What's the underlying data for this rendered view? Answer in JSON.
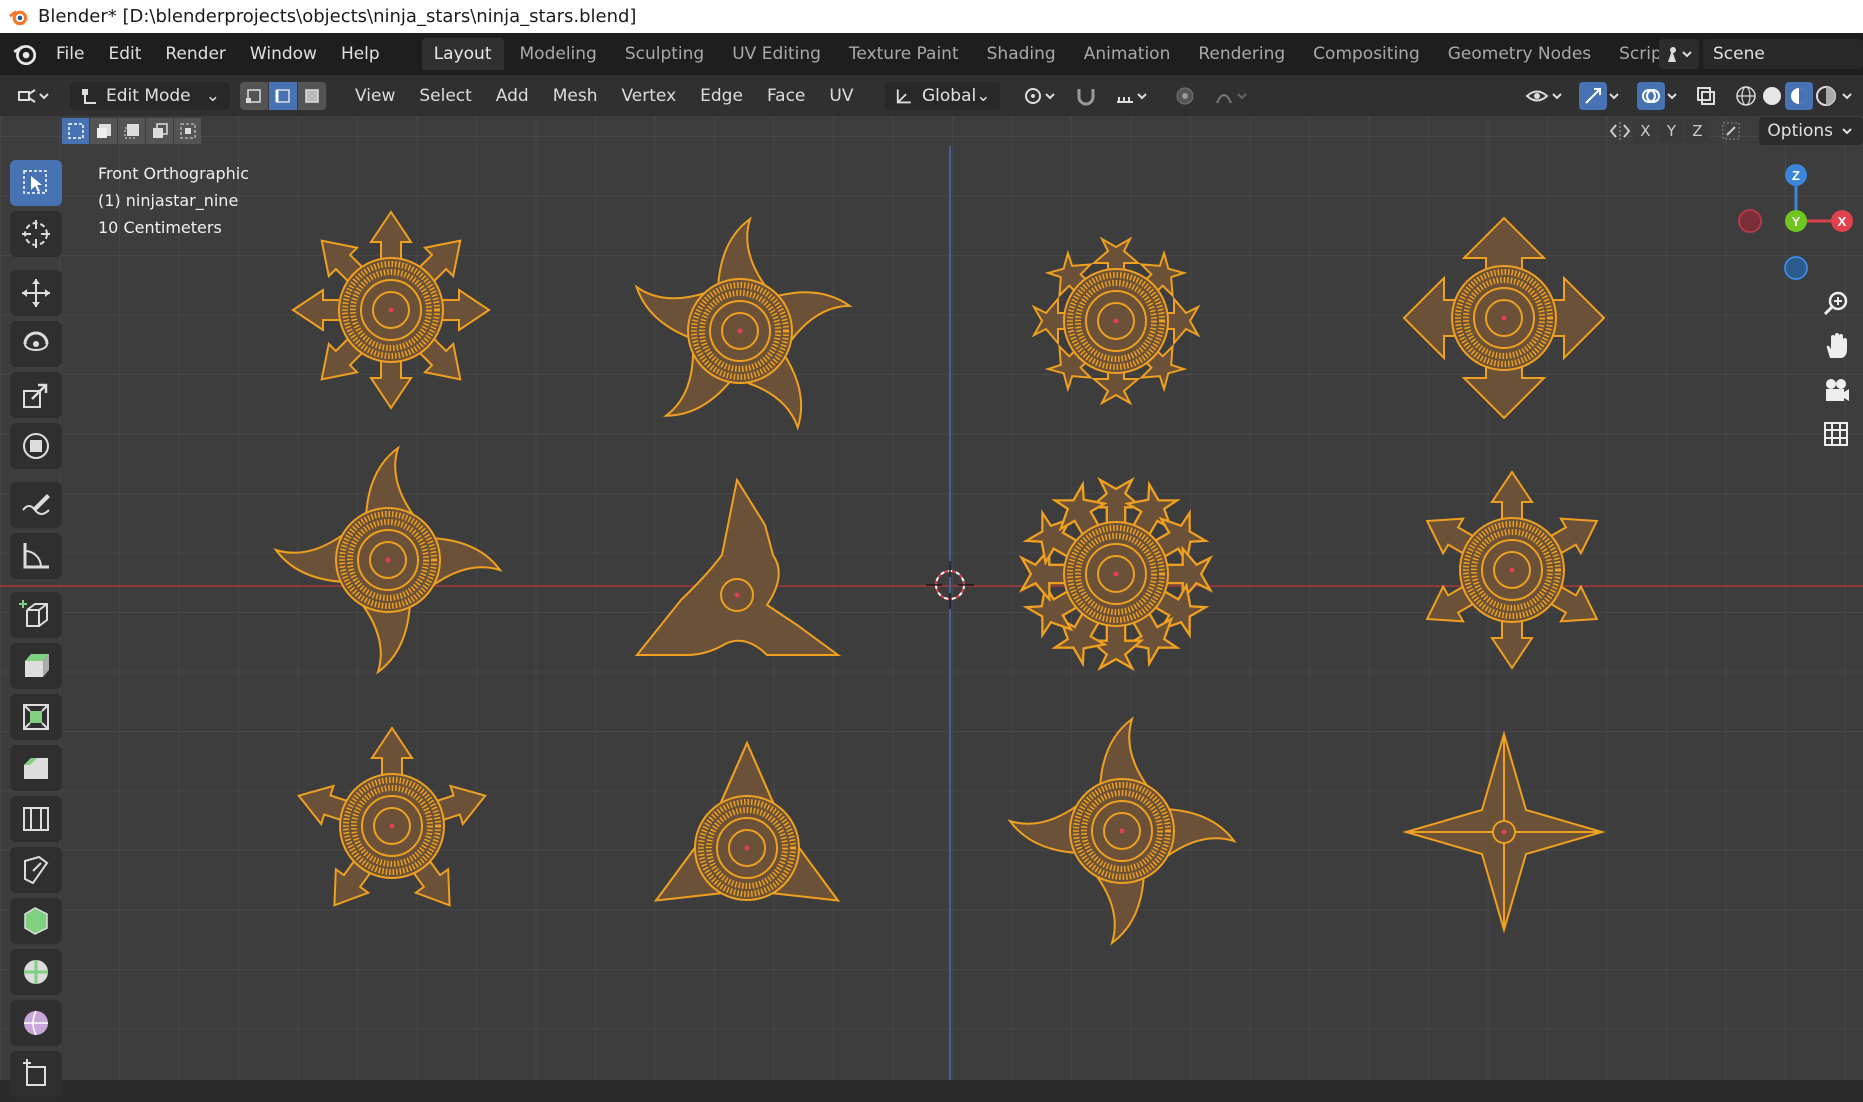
{
  "window": {
    "title": "Blender* [D:\\blenderprojects\\objects\\ninja_stars\\ninja_stars.blend]"
  },
  "menubar": {
    "items": [
      "File",
      "Edit",
      "Render",
      "Window",
      "Help"
    ]
  },
  "workspaces": {
    "tabs": [
      "Layout",
      "Modeling",
      "Sculpting",
      "UV Editing",
      "Texture Paint",
      "Shading",
      "Animation",
      "Rendering",
      "Compositing",
      "Geometry Nodes",
      "Scripting"
    ],
    "active": "Layout"
  },
  "scene": {
    "label": "Scene"
  },
  "header": {
    "mode": "Edit Mode",
    "menus": [
      "View",
      "Select",
      "Add",
      "Mesh",
      "Vertex",
      "Edge",
      "Face",
      "UV"
    ],
    "transform_orientation": "Global"
  },
  "viewport": {
    "view_name": "Front Orthographic",
    "object_name": "(1) ninjastar_nine",
    "scale": "10 Centimeters",
    "options_label": "Options",
    "axis_buttons": [
      "X",
      "Y",
      "Z"
    ],
    "gizmo": {
      "z": "Z",
      "y": "Y",
      "x": "X"
    }
  },
  "colors": {
    "accent": "#4772b3",
    "mesh_edge": "#f0a020",
    "mesh_face": "#6a5138",
    "axis_x": "#e0414c",
    "axis_y": "#6ec61e",
    "axis_z": "#3b86d9"
  },
  "toolbar": {
    "tools": [
      "select-box",
      "cursor",
      "move",
      "rotate",
      "scale",
      "transform",
      "annotate",
      "measure",
      "add-cube",
      "extrude",
      "inset",
      "bevel",
      "loop-cut",
      "knife",
      "poly-build",
      "spin",
      "smooth",
      "shrink"
    ]
  }
}
